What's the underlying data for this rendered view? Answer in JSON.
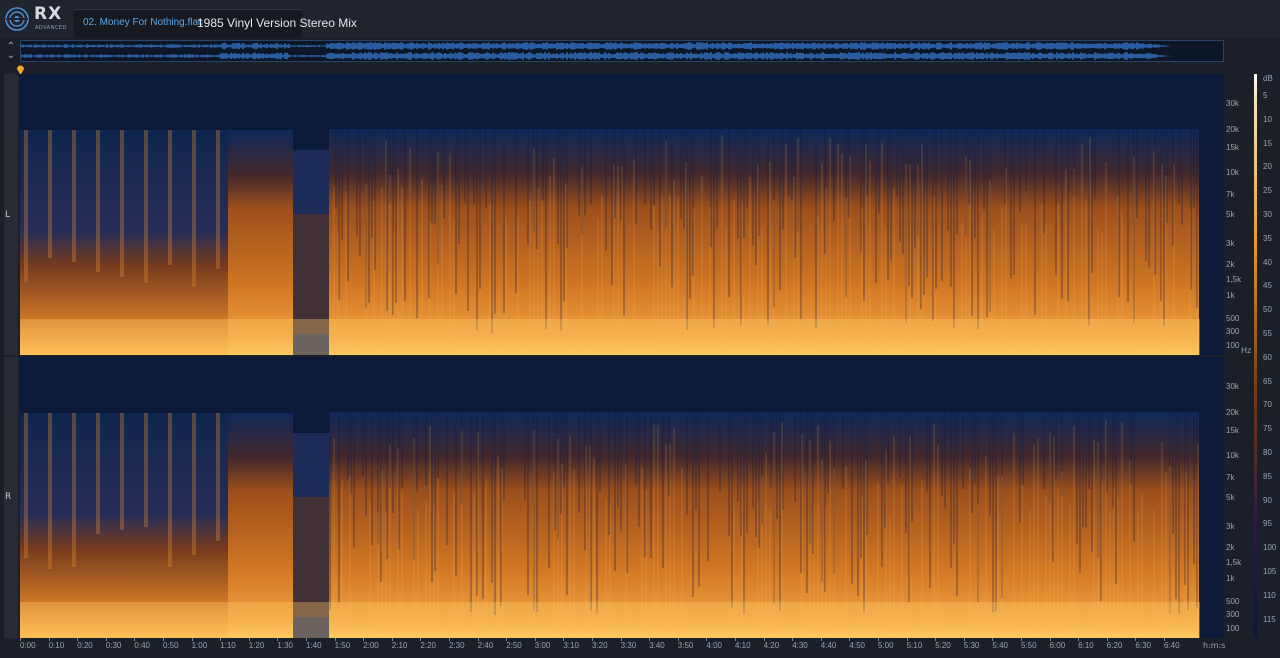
{
  "app": {
    "logo_text": "RX",
    "logo_sub": "ADVANCED"
  },
  "tab": {
    "file_name": "02. Money For Nothing.flac",
    "description": "1985 Vinyl Version Stereo Mix"
  },
  "channels": [
    "L",
    "R"
  ],
  "freq_axis": {
    "unit": "Hz",
    "ticks": [
      "30k",
      "20k",
      "15k",
      "10k",
      "7k",
      "5k",
      "3k",
      "2k",
      "1,5k",
      "1k",
      "500",
      "300",
      "100"
    ]
  },
  "db_axis": {
    "unit": "dB",
    "ticks": [
      "5",
      "10",
      "15",
      "20",
      "25",
      "30",
      "35",
      "40",
      "45",
      "50",
      "55",
      "60",
      "65",
      "70",
      "75",
      "80",
      "85",
      "90",
      "95",
      "100",
      "105",
      "110",
      "115"
    ]
  },
  "time_axis": {
    "unit": "h:m:s",
    "ticks": [
      "0:00",
      "0:10",
      "0:20",
      "0:30",
      "0:40",
      "0:50",
      "1:00",
      "1:10",
      "1:20",
      "1:30",
      "1:40",
      "1:50",
      "2:00",
      "2:10",
      "2:20",
      "2:30",
      "2:40",
      "2:50",
      "3:00",
      "3:10",
      "3:20",
      "3:30",
      "3:40",
      "3:50",
      "4:00",
      "4:10",
      "4:20",
      "4:30",
      "4:40",
      "4:50",
      "5:00",
      "5:10",
      "5:20",
      "5:30",
      "5:40",
      "5:50",
      "6:00",
      "6:10",
      "6:20",
      "6:30",
      "6:40"
    ]
  },
  "colors": {
    "accent": "#5aa7e8",
    "spectrogram_low": "#0c1a3a",
    "spectrogram_mid": "#c5641a",
    "spectrogram_high": "#ffd37a"
  }
}
